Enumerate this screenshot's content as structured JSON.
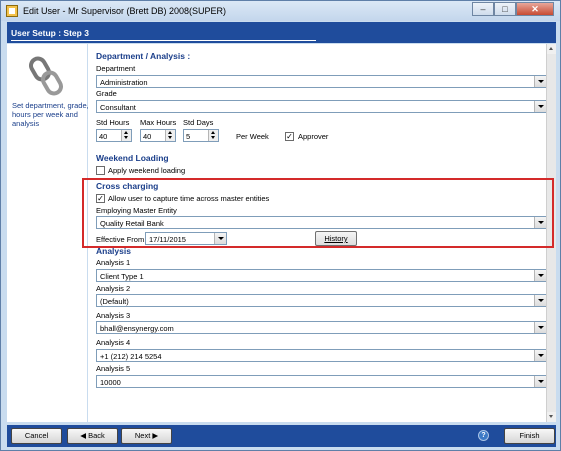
{
  "window": {
    "title": "Edit User - Mr Supervisor (Brett DB) 2008(SUPER)"
  },
  "step": {
    "label": "User Setup :   Step 3"
  },
  "left": {
    "description": "Set department, grade, hours per week and analysis"
  },
  "dept": {
    "header": "Department / Analysis :",
    "department_label": "Department",
    "department_value": "Administration",
    "grade_label": "Grade",
    "grade_value": "Consultant",
    "std_hours_label": "Std Hours",
    "std_hours_value": "40",
    "max_hours_label": "Max Hours",
    "max_hours_value": "40",
    "std_days_label": "Std Days",
    "std_days_value": "5",
    "per_week_label": "Per Week",
    "approver_label": "Approver",
    "approver_checked": true
  },
  "weekend": {
    "header": "Weekend Loading",
    "apply_label": "Apply weekend loading",
    "apply_checked": false
  },
  "cross": {
    "header": "Cross charging",
    "allow_label": "Allow user to capture time across master entities",
    "allow_checked": true,
    "employing_label": "Employing Master Entity",
    "employing_value": "Quality Retail Bank",
    "effective_label": "Effective From",
    "effective_value": "17/11/2015",
    "history_button": "History"
  },
  "analysis": {
    "header": "Analysis",
    "items": [
      {
        "label": "Analysis 1",
        "value": "Client Type 1"
      },
      {
        "label": "Analysis 2",
        "value": "(Default)"
      },
      {
        "label": "Analysis 3",
        "value": "bhall@ensynergy.com"
      },
      {
        "label": "Analysis 4",
        "value": "+1 (212) 214 5254"
      },
      {
        "label": "Analysis 5",
        "value": "10000"
      }
    ]
  },
  "footer": {
    "cancel": "Cancel",
    "back": "Back",
    "next": "Next",
    "finish": "Finish"
  },
  "colors": {
    "accent": "#1f4c9c",
    "highlight": "#d42a2a",
    "section": "#1a3e8a"
  }
}
